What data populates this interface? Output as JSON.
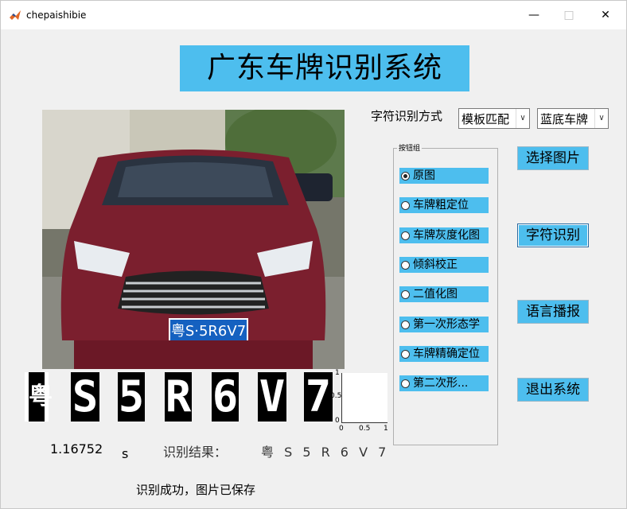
{
  "window": {
    "title": "chepaishibie"
  },
  "banner": {
    "title": "广东车牌识别系统"
  },
  "photo": {
    "plate_text": "粤S·5R6V7"
  },
  "controls": {
    "method_label": "字符识别方式",
    "method_select": "模板匹配",
    "plate_type_select": "蓝底车牌"
  },
  "radio_group": {
    "title": "按钮组",
    "items": [
      {
        "label": "原图",
        "selected": true
      },
      {
        "label": "车牌粗定位",
        "selected": false
      },
      {
        "label": "车牌灰度化图",
        "selected": false
      },
      {
        "label": "倾斜校正",
        "selected": false
      },
      {
        "label": "二值化图",
        "selected": false
      },
      {
        "label": "第一次形态学",
        "selected": false
      },
      {
        "label": "车牌精确定位",
        "selected": false
      },
      {
        "label": "第二次形...",
        "selected": false
      }
    ]
  },
  "buttons": {
    "select_image": "选择图片",
    "recognize": "字符识别",
    "voice": "语言播报",
    "exit": "退出系统"
  },
  "segmented_chars": [
    "粤",
    "S",
    "5",
    "R",
    "6",
    "V",
    "7"
  ],
  "axes": {
    "y_ticks": [
      "1",
      "0.5",
      "0"
    ],
    "x_ticks": [
      "0",
      "0.5",
      "1"
    ]
  },
  "results": {
    "time_value": "1.16752",
    "time_unit": "s",
    "result_label": "识别结果：",
    "result_value": "粤 S 5 R 6 V 7",
    "status": "识别成功，图片已保存"
  }
}
